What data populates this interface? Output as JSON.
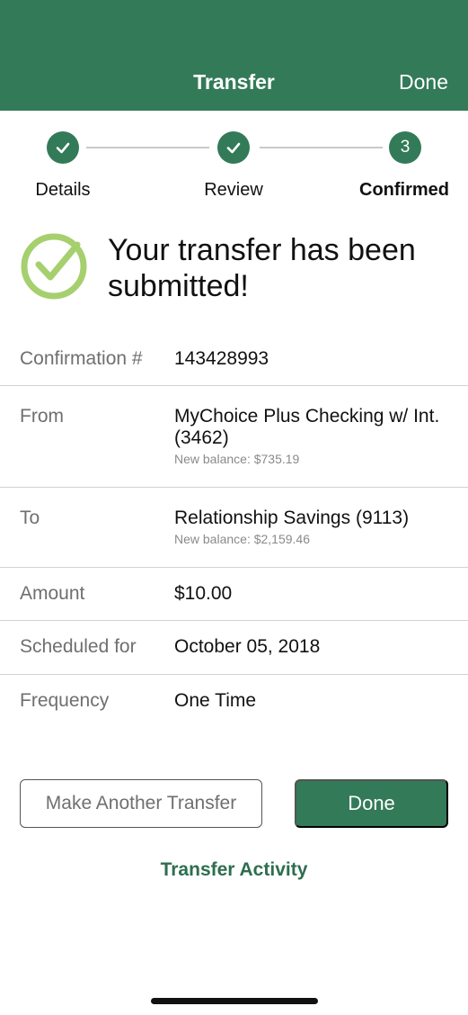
{
  "header": {
    "title": "Transfer",
    "done_label": "Done"
  },
  "stepper": {
    "steps": [
      {
        "label": "Details",
        "state": "complete",
        "marker": "check-icon"
      },
      {
        "label": "Review",
        "state": "complete",
        "marker": "check-icon"
      },
      {
        "label": "Confirmed",
        "state": "current",
        "marker": "3"
      }
    ]
  },
  "success": {
    "message": "Your transfer has been submitted!",
    "icon": "check-circle-icon"
  },
  "details": {
    "confirmation": {
      "label": "Confirmation #",
      "value": "143428993"
    },
    "from": {
      "label": "From",
      "value": "MyChoice Plus Checking w/ Int. (3462)",
      "balance": "New balance:  $735.19"
    },
    "to": {
      "label": "To",
      "value": "Relationship Savings (9113)",
      "balance": "New balance:  $2,159.46"
    },
    "amount": {
      "label": "Amount",
      "value": "$10.00"
    },
    "scheduled": {
      "label": "Scheduled for",
      "value": "October 05, 2018"
    },
    "frequency": {
      "label": "Frequency",
      "value": "One Time"
    }
  },
  "actions": {
    "make_another_label": "Make Another Transfer",
    "done_label": "Done",
    "activity_link": "Transfer Activity"
  },
  "colors": {
    "brand": "#337a58",
    "success_icon": "#a6cf6e"
  }
}
